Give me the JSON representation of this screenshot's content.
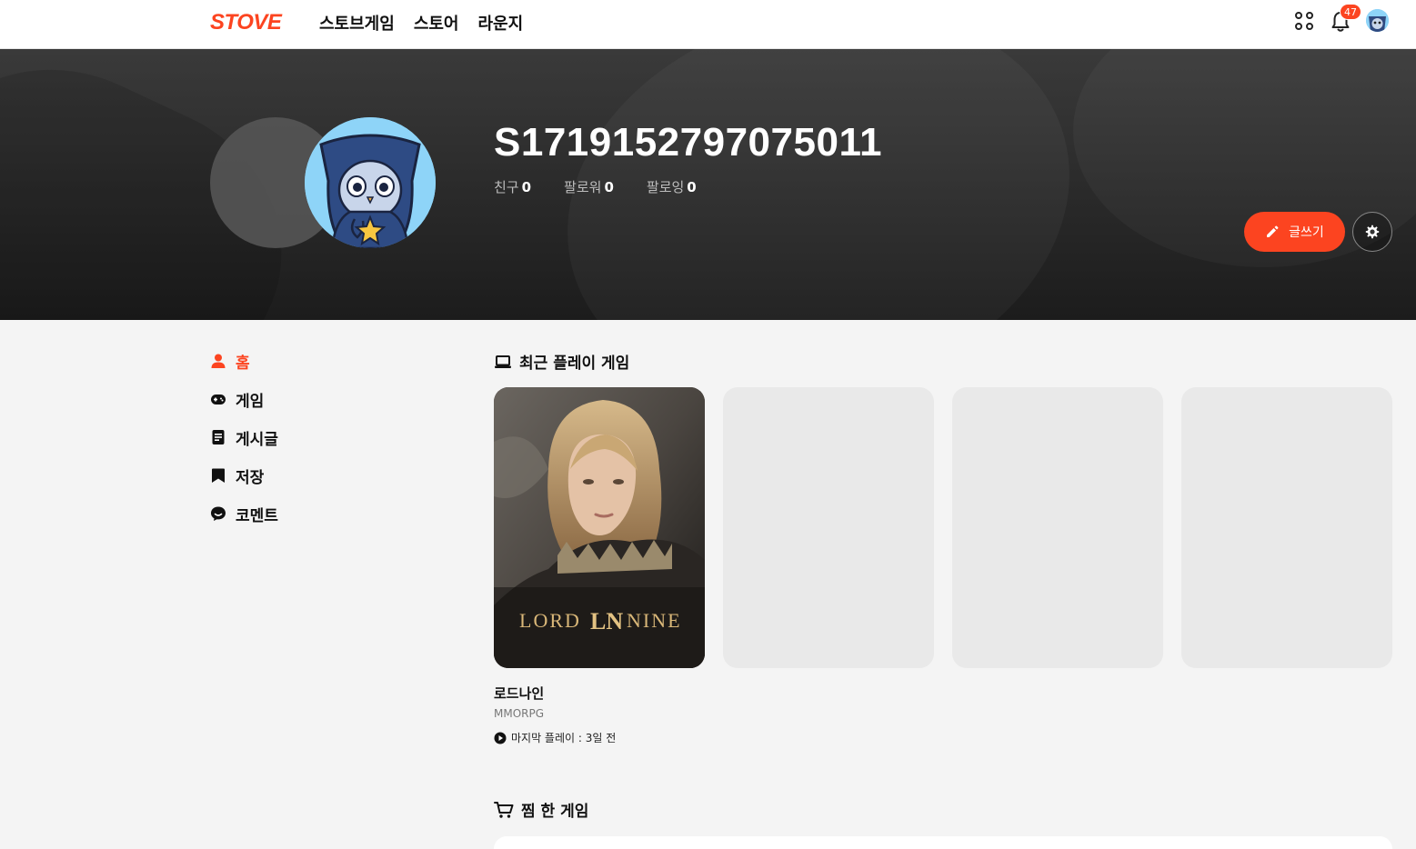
{
  "topnav": {
    "logo": "STOVE",
    "items": [
      {
        "label": "스토브게임"
      },
      {
        "label": "스토어"
      },
      {
        "label": "라운지"
      }
    ],
    "notification_count": "47"
  },
  "profile": {
    "username": "S1719152797075011",
    "stats": [
      {
        "label": "친구",
        "value": "0"
      },
      {
        "label": "팔로워",
        "value": "0"
      },
      {
        "label": "팔로잉",
        "value": "0"
      }
    ],
    "write_label": "글쓰기"
  },
  "sidebar": {
    "items": [
      {
        "label": "홈",
        "icon": "person-icon",
        "active": true
      },
      {
        "label": "게임",
        "icon": "gamepad-icon"
      },
      {
        "label": "게시글",
        "icon": "document-icon"
      },
      {
        "label": "저장",
        "icon": "bookmark-icon"
      },
      {
        "label": "코멘트",
        "icon": "comment-icon"
      }
    ]
  },
  "recent": {
    "title": "최근 플레이 게임",
    "game": {
      "logo_text": "LORD LN NINE",
      "name": "로드나인",
      "genre": "MMORPG",
      "last_played": "마지막 플레이 : 3일 전"
    }
  },
  "wishlist": {
    "title": "찜 한 게임"
  },
  "colors": {
    "accent": "#fc4420",
    "hero_bg": "#2b2b2b",
    "page_bg": "#f4f4f4",
    "placeholder": "#e9e9e9"
  }
}
